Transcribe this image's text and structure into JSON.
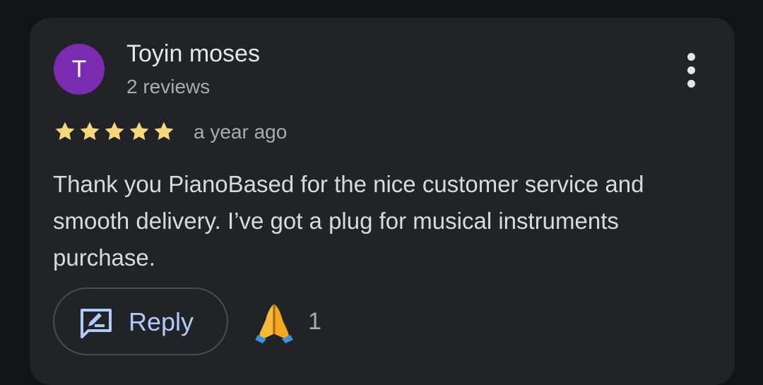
{
  "review": {
    "avatar_letter": "T",
    "author_name": "Toyin moses",
    "author_reviews": "2 reviews",
    "rating": 5,
    "rating_max": 5,
    "date": "a year ago",
    "text": "Thank you PianoBased for the nice customer service and smooth delivery. I’ve got a plug for musical instruments purchase.",
    "reply_label": "Reply",
    "reaction_count": "1"
  },
  "colors": {
    "background": "#121316",
    "card": "#222327",
    "avatar": "#7b2bb0",
    "star": "#f6d77c",
    "reply_accent": "#aecbfa"
  },
  "icons": {
    "more": "more-vertical-icon",
    "reply": "reply-edit-icon",
    "reaction": "folded-hands-emoji-icon"
  }
}
